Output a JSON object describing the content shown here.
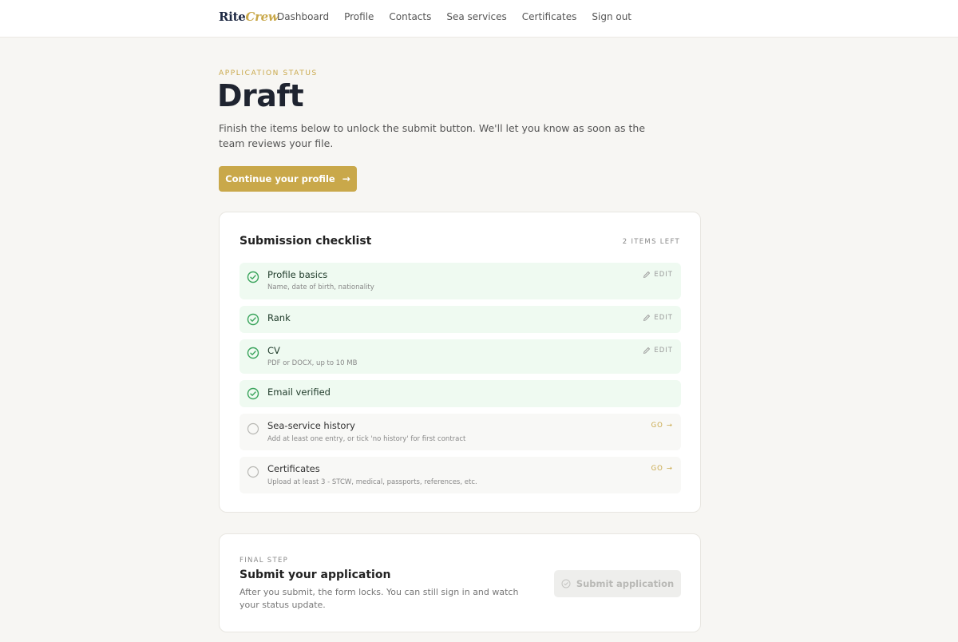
{
  "brand": {
    "part1": "Rite",
    "part2": "Crew"
  },
  "nav": [
    "Dashboard",
    "Profile",
    "Contacts",
    "Sea services",
    "Certificates",
    "Sign out"
  ],
  "status": {
    "eyebrow": "APPLICATION STATUS",
    "title": "Draft",
    "intro": "Finish the items below to unlock the submit button. We'll let you know as soon as the team reviews your file.",
    "cta_label": "Continue your profile",
    "cta_icon": "arrow-right-icon"
  },
  "checklist": {
    "title": "Submission checklist",
    "items_left": "2 ITEMS LEFT",
    "items": [
      {
        "title": "Profile basics",
        "subtitle": "Name, date of birth, nationality",
        "done": true,
        "action": "EDIT"
      },
      {
        "title": "Rank",
        "subtitle": "",
        "done": true,
        "action": "EDIT"
      },
      {
        "title": "CV",
        "subtitle": "PDF or DOCX, up to 10 MB",
        "done": true,
        "action": "EDIT"
      },
      {
        "title": "Email verified",
        "subtitle": "",
        "done": true,
        "action": ""
      },
      {
        "title": "Sea-service history",
        "subtitle": "Add at least one entry, or tick 'no history' for first contract",
        "done": false,
        "action": "GO"
      },
      {
        "title": "Certificates",
        "subtitle": "Upload at least 3 - STCW, medical, passports, references, etc.",
        "done": false,
        "action": "GO"
      }
    ]
  },
  "submit": {
    "eyebrow": "FINAL STEP",
    "title": "Submit your application",
    "description": "After you submit, the form locks. You can still sign in and watch your status update.",
    "button_label": "Submit application"
  },
  "colors": {
    "accent": "#c9a84a",
    "done_bg": "#effaf1",
    "done_icon": "#3aa45c",
    "page_bg": "#f7f6f3"
  }
}
